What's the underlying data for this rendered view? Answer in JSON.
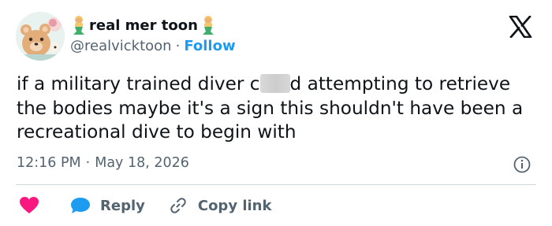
{
  "author": {
    "display_name": "real mer toon",
    "handle": "@realvicktoon",
    "separator": "·",
    "follow_label": "Follow"
  },
  "icons": {
    "avatar": "avatar-bear-illustration",
    "name_emoji": "merperson-emoji",
    "platform": "x-logo-icon",
    "info": "info-icon",
    "like": "heart-icon",
    "reply": "reply-bubble-icon",
    "copy": "link-icon"
  },
  "tweet": {
    "text_before": "if a military trained diver c",
    "text_after": "d attempting to retrieve the bodies maybe it's a sign this shouldn't have been a recreational dive to begin with"
  },
  "meta": {
    "time": "12:16 PM",
    "separator": "·",
    "date": "May 18, 2026"
  },
  "actions": {
    "reply_label": "Reply",
    "copy_label": "Copy link"
  },
  "colors": {
    "text": "#0f1419",
    "secondary": "#536471",
    "link_blue": "#1d9bf0",
    "heart_pink": "#f91880",
    "divider": "#cfd9de"
  }
}
